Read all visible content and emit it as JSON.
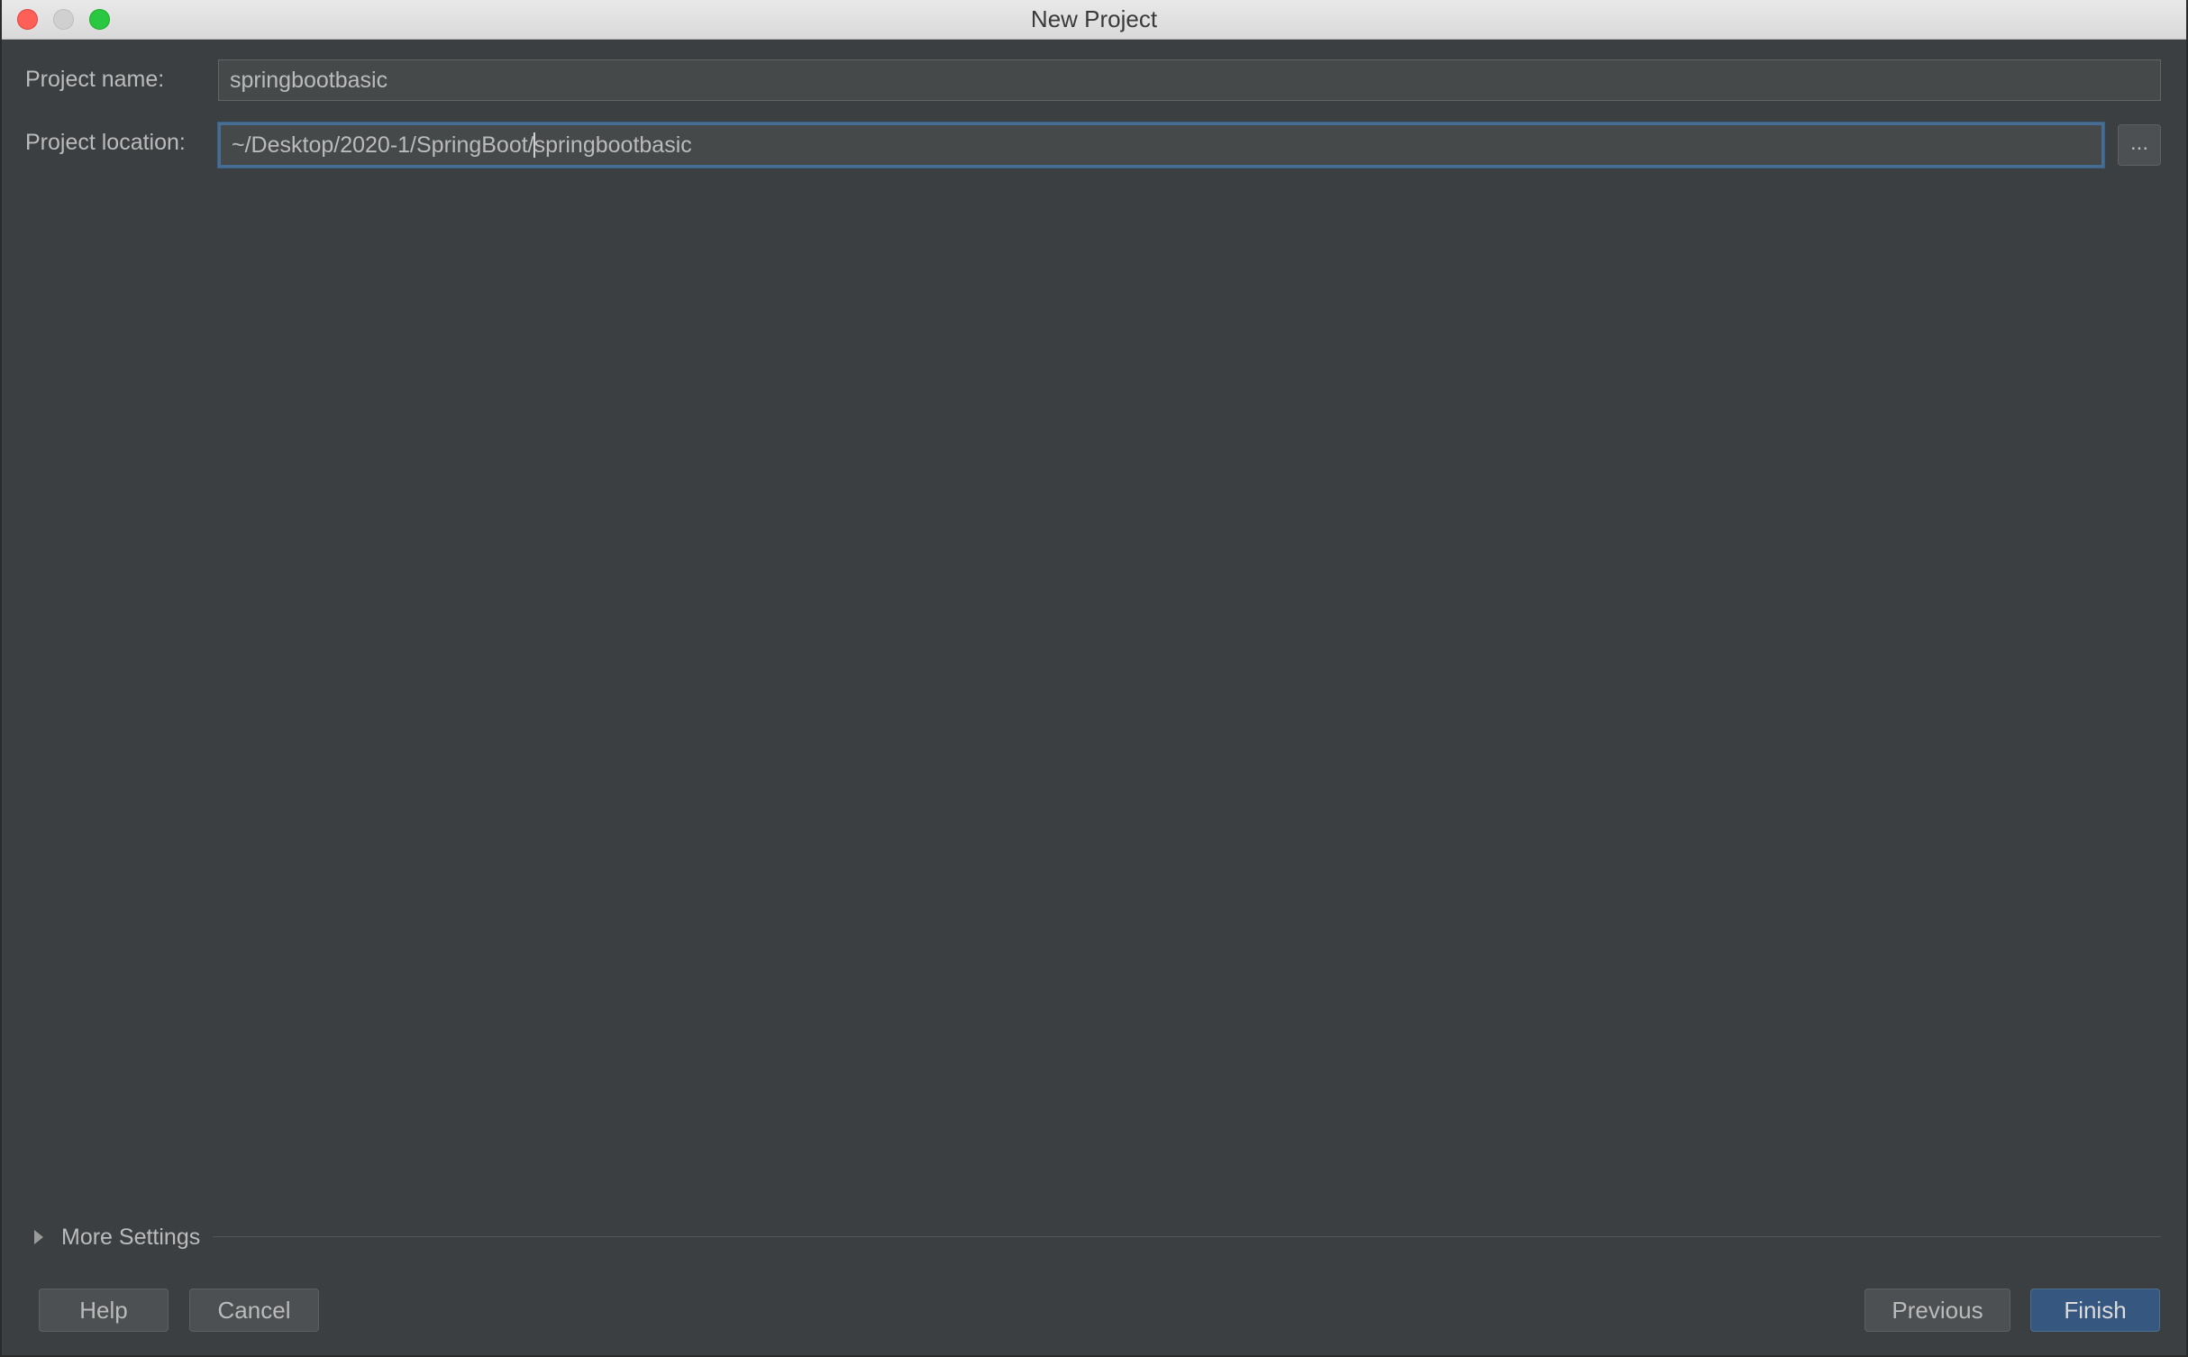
{
  "window": {
    "title": "New Project"
  },
  "form": {
    "project_name_label": "Project name:",
    "project_name_value": "springbootbasic",
    "project_location_label": "Project location:",
    "project_location_before_caret": "~/Desktop/2020-1/SpringBoot/",
    "project_location_after_caret": "springbootbasic",
    "browse_label": "..."
  },
  "more_settings": {
    "label": "More Settings"
  },
  "buttons": {
    "help": "Help",
    "cancel": "Cancel",
    "previous": "Previous",
    "finish": "Finish"
  },
  "colors": {
    "background": "#3c3f41",
    "field_background": "#45494a",
    "focus_border": "#466d94",
    "primary_button": "#365880",
    "text": "#bbbbbb"
  }
}
